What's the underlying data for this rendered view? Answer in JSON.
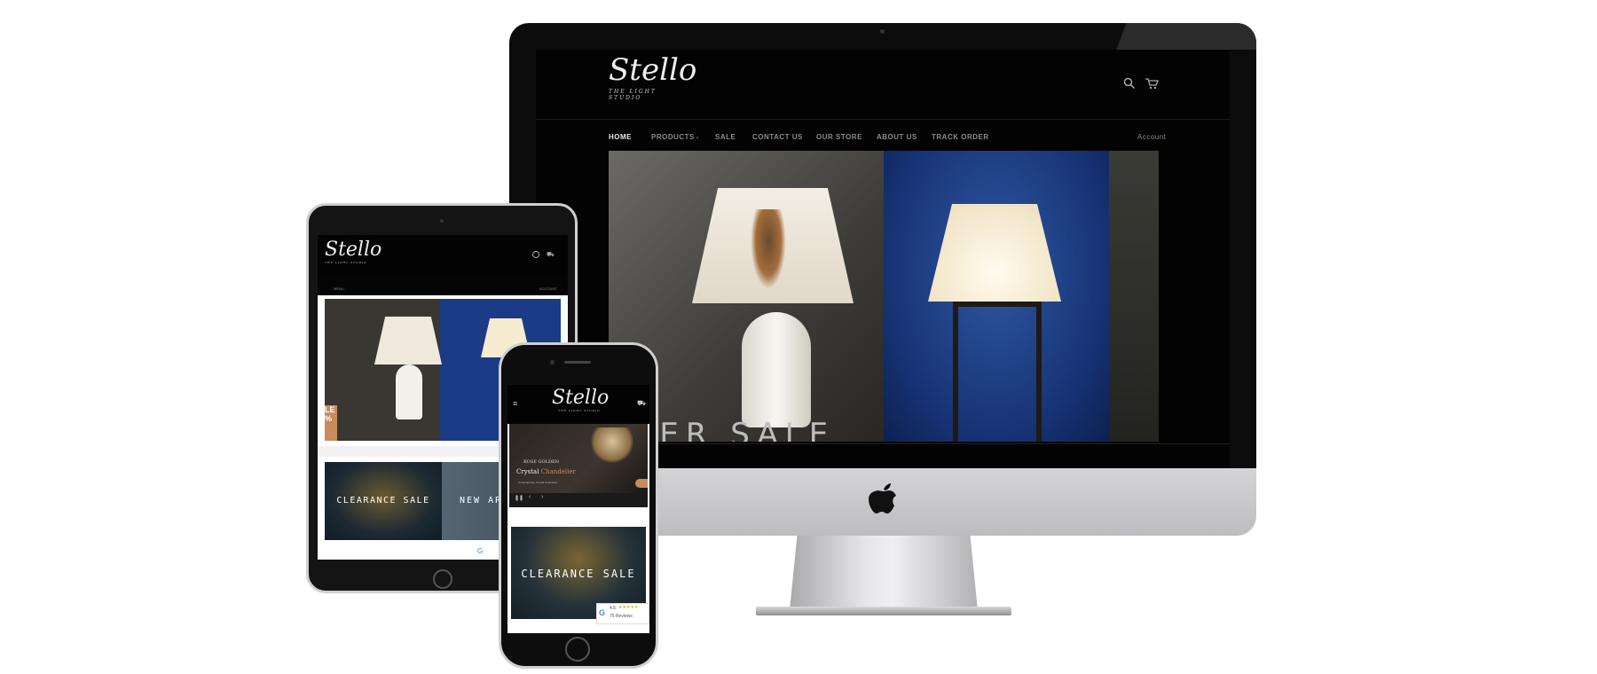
{
  "brand": {
    "logo": "Stello",
    "tagline": "THE LIGHT STUDIO"
  },
  "desktop": {
    "nav": [
      "HOME",
      "PRODUCTS",
      "SALE",
      "CONTACT US",
      "OUR STORE",
      "ABOUT US",
      "TRACK ORDER"
    ],
    "account": "Account",
    "hero_text": "UPER SALE",
    "icons": [
      "search-icon",
      "cart-icon"
    ]
  },
  "tablet": {
    "menu": "MENU",
    "account": "ACCOUNT",
    "badge": "LE",
    "badge_sub": "%",
    "banner_left": "CLEARANCE SALE",
    "banner_right": "NEW AR"
  },
  "phone": {
    "slide_line1": "ROSE GOLDEN",
    "slide_line2a": "Crystal",
    "slide_line2b": "Chandelier",
    "slide_line3": "Contemporary Crystal Chandelier",
    "banner": "CLEARANCE SALE",
    "rating": "4.5",
    "reviews": "75 Reviews"
  },
  "colors": {
    "accent": "#c98b5b",
    "dark": "#030303",
    "hero_blue": "#1b3b86"
  }
}
